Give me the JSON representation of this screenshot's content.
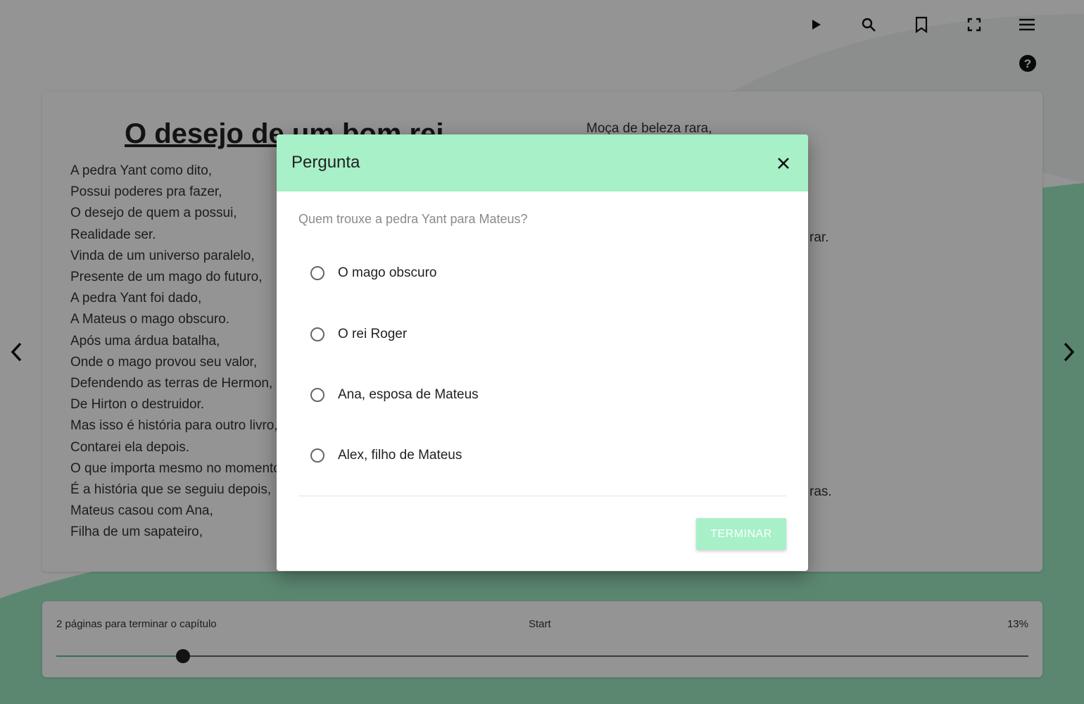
{
  "colors": {
    "accent": "#a7f0c8",
    "teal": "#6fd6a6",
    "overlay": "rgba(0,0,0,0.42)"
  },
  "toolbar": {
    "icons": [
      "play-icon",
      "search-icon",
      "bookmark-icon",
      "fullscreen-icon",
      "menu-icon",
      "help-icon"
    ]
  },
  "book": {
    "title": "O desejo de um bom rei",
    "lines": [
      "A pedra Yant como dito,",
      "Possui poderes pra fazer,",
      "O desejo de quem a possui,",
      "Realidade ser.",
      "Vinda de um universo paralelo,",
      "Presente de um mago do futuro,",
      "A pedra Yant foi dado,",
      "A Mateus o mago obscuro.",
      "Após uma árdua batalha,",
      "Onde o mago provou seu valor,",
      "Defendendo as terras de Hermon,",
      "De Hirton o destruidor.",
      "Mas isso é história para outro livro,",
      "Contarei ela depois.",
      "O que importa mesmo no momento,",
      "É a história que se seguiu depois,",
      "Mateus casou com Ana,",
      "Filha de um sapateiro,"
    ],
    "col2_first_line": "Moça de beleza rara,",
    "col2_fragment_1": "rar.",
    "col2_fragment_2": "ras."
  },
  "progress": {
    "pages_left": "2 páginas para terminar o capítulo",
    "chapter": "Start",
    "percent_label": "13%",
    "value": 0.13
  },
  "dialog": {
    "title": "Pergunta",
    "question": "Quem trouxe a pedra Yant para Mateus?",
    "options": [
      "O mago obscuro",
      "O rei Roger",
      "Ana, esposa de Mateus",
      "Alex, filho de Mateus"
    ],
    "finish_label": "TERMINAR"
  }
}
